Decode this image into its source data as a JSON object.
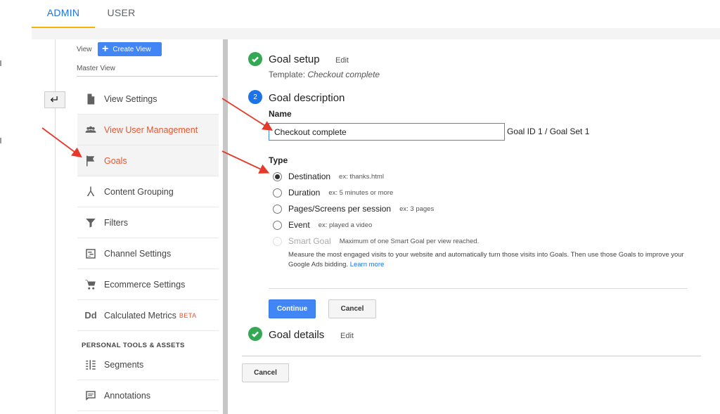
{
  "tabs": [
    {
      "label": "ADMIN"
    },
    {
      "label": "USER"
    }
  ],
  "view": {
    "label": "View",
    "create_button": "Create View",
    "master_view": "Master View"
  },
  "nav": {
    "items": [
      {
        "label": "View Settings",
        "icon": "document-icon"
      },
      {
        "label": "View User Management",
        "icon": "people-icon"
      },
      {
        "label": "Goals",
        "icon": "flag-icon"
      },
      {
        "label": "Content Grouping",
        "icon": "grouping-icon"
      },
      {
        "label": "Filters",
        "icon": "filter-icon"
      },
      {
        "label": "Channel Settings",
        "icon": "channel-icon"
      },
      {
        "label": "Ecommerce Settings",
        "icon": "cart-icon"
      },
      {
        "label": "Calculated Metrics",
        "icon": "dd-icon",
        "badge": "BETA"
      },
      {
        "label": "Segments",
        "icon": "segments-icon"
      },
      {
        "label": "Annotations",
        "icon": "annotation-icon"
      }
    ],
    "section_title": "PERSONAL TOOLS & ASSETS"
  },
  "goal_setup": {
    "title": "Goal setup",
    "edit": "Edit",
    "template_label": "Template:",
    "template_value": "Checkout complete"
  },
  "goal_description": {
    "step_number": "2",
    "title": "Goal description",
    "name_label": "Name",
    "name_value": "Checkout complete",
    "goal_id": "Goal ID 1 / Goal Set 1",
    "type_label": "Type",
    "types": [
      {
        "label": "Destination",
        "example": "ex: thanks.html",
        "selected": true
      },
      {
        "label": "Duration",
        "example": "ex: 5 minutes or more"
      },
      {
        "label": "Pages/Screens per session",
        "example": "ex: 3 pages"
      },
      {
        "label": "Event",
        "example": "ex: played a video"
      },
      {
        "label": "Smart Goal",
        "example": "Maximum of one Smart Goal per view reached.",
        "disabled": true
      }
    ],
    "smart_desc": "Measure the most engaged visits to your website and automatically turn those visits into Goals. Then use those Goals to improve your Google Ads bidding.",
    "learn_more": "Learn more",
    "continue": "Continue",
    "cancel": "Cancel"
  },
  "goal_details": {
    "title": "Goal details",
    "edit": "Edit"
  },
  "bottom_cancel": "Cancel",
  "colors": {
    "accent": "#4285f4",
    "highlight": "#e8542e",
    "success": "#34a853",
    "tab_underline": "#f4b400"
  }
}
